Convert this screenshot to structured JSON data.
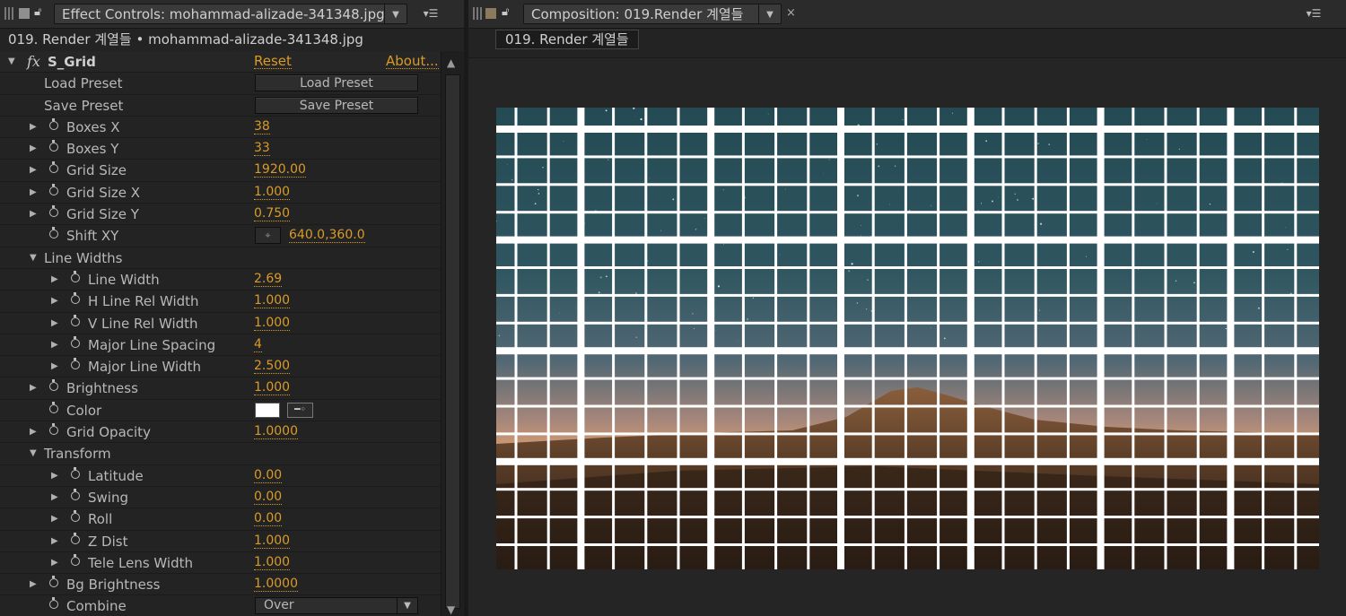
{
  "effect_panel": {
    "tab_title": "Effect Controls: mohammad-alizade-341348.jpg",
    "subtitle": "019. Render 계열들 • mohammad-alizade-341348.jpg",
    "effect_name": "S_Grid",
    "reset_label": "Reset",
    "about_label": "About...",
    "load_preset_label": "Load Preset",
    "load_preset_button": "Load Preset",
    "save_preset_label": "Save Preset",
    "save_preset_button": "Save Preset",
    "params": {
      "boxes_x": {
        "label": "Boxes X",
        "value": "38"
      },
      "boxes_y": {
        "label": "Boxes Y",
        "value": "33"
      },
      "grid_size": {
        "label": "Grid Size",
        "value": "1920.00"
      },
      "grid_size_x": {
        "label": "Grid Size X",
        "value": "1.000"
      },
      "grid_size_y": {
        "label": "Grid Size Y",
        "value": "0.750"
      },
      "shift_xy": {
        "label": "Shift XY",
        "value": "640.0,360.0"
      },
      "line_widths": {
        "label": "Line Widths"
      },
      "line_width": {
        "label": "Line Width",
        "value": "2.69"
      },
      "h_line_rel_width": {
        "label": "H Line Rel Width",
        "value": "1.000"
      },
      "v_line_rel_width": {
        "label": "V Line Rel Width",
        "value": "1.000"
      },
      "major_line_spacing": {
        "label": "Major Line Spacing",
        "value": "4"
      },
      "major_line_width": {
        "label": "Major Line Width",
        "value": "2.500"
      },
      "brightness": {
        "label": "Brightness",
        "value": "1.000"
      },
      "color": {
        "label": "Color",
        "value": "#ffffff"
      },
      "grid_opacity": {
        "label": "Grid Opacity",
        "value": "1.0000"
      },
      "transform": {
        "label": "Transform"
      },
      "latitude": {
        "label": "Latitude",
        "value": "0.00"
      },
      "swing": {
        "label": "Swing",
        "value": "0.00"
      },
      "roll": {
        "label": "Roll",
        "value": "0.00"
      },
      "z_dist": {
        "label": "Z Dist",
        "value": "1.000"
      },
      "tele_lens_width": {
        "label": "Tele Lens Width",
        "value": "1.000"
      },
      "bg_brightness": {
        "label": "Bg Brightness",
        "value": "1.0000"
      },
      "combine": {
        "label": "Combine",
        "value": "Over"
      }
    }
  },
  "composition_panel": {
    "tab_title": "Composition: 019.Render 계열들",
    "comp_tab": "019. Render 계열들"
  },
  "colors": {
    "accent": "#d99b28",
    "grid_line": "#ffffff",
    "sky_top": "#2b5560",
    "horizon_glow": "#c8906a",
    "ground": "#4a3322"
  }
}
